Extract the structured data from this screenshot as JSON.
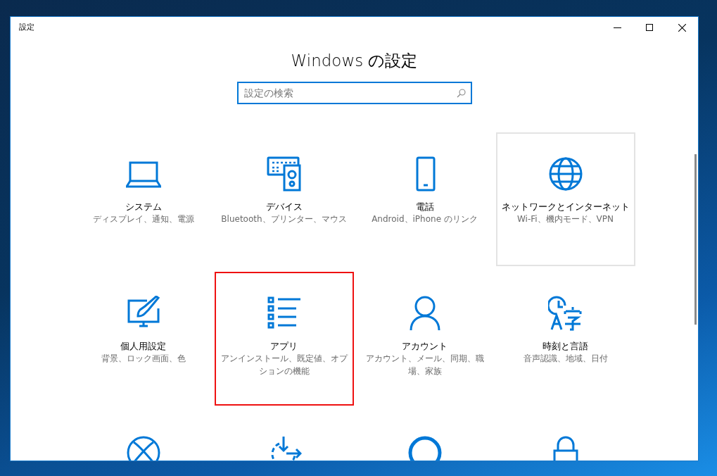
{
  "window": {
    "title": "設定"
  },
  "heading": "Windows の設定",
  "search": {
    "placeholder": "設定の検索"
  },
  "tiles": [
    {
      "title": "システム",
      "subtitle": "ディスプレイ、通知、電源",
      "hovered": false,
      "highlighted": false
    },
    {
      "title": "デバイス",
      "subtitle": "Bluetooth、プリンター、マウス",
      "hovered": false,
      "highlighted": false
    },
    {
      "title": "電話",
      "subtitle": "Android、iPhone のリンク",
      "hovered": false,
      "highlighted": false
    },
    {
      "title": "ネットワークとインターネット",
      "subtitle": "Wi-Fi、機内モード、VPN",
      "hovered": true,
      "highlighted": false
    },
    {
      "title": "個人用設定",
      "subtitle": "背景、ロック画面、色",
      "hovered": false,
      "highlighted": false
    },
    {
      "title": "アプリ",
      "subtitle": "アンインストール、既定値、オプションの機能",
      "hovered": false,
      "highlighted": true
    },
    {
      "title": "アカウント",
      "subtitle": "アカウント、メール、同期、職場、家族",
      "hovered": false,
      "highlighted": false
    },
    {
      "title": "時刻と言語",
      "subtitle": "音声認識、地域、日付",
      "hovered": false,
      "highlighted": false
    },
    {
      "hovered": false,
      "highlighted": false
    },
    {
      "hovered": false,
      "highlighted": false
    },
    {
      "hovered": false,
      "highlighted": false
    },
    {
      "hovered": false,
      "highlighted": false
    }
  ]
}
